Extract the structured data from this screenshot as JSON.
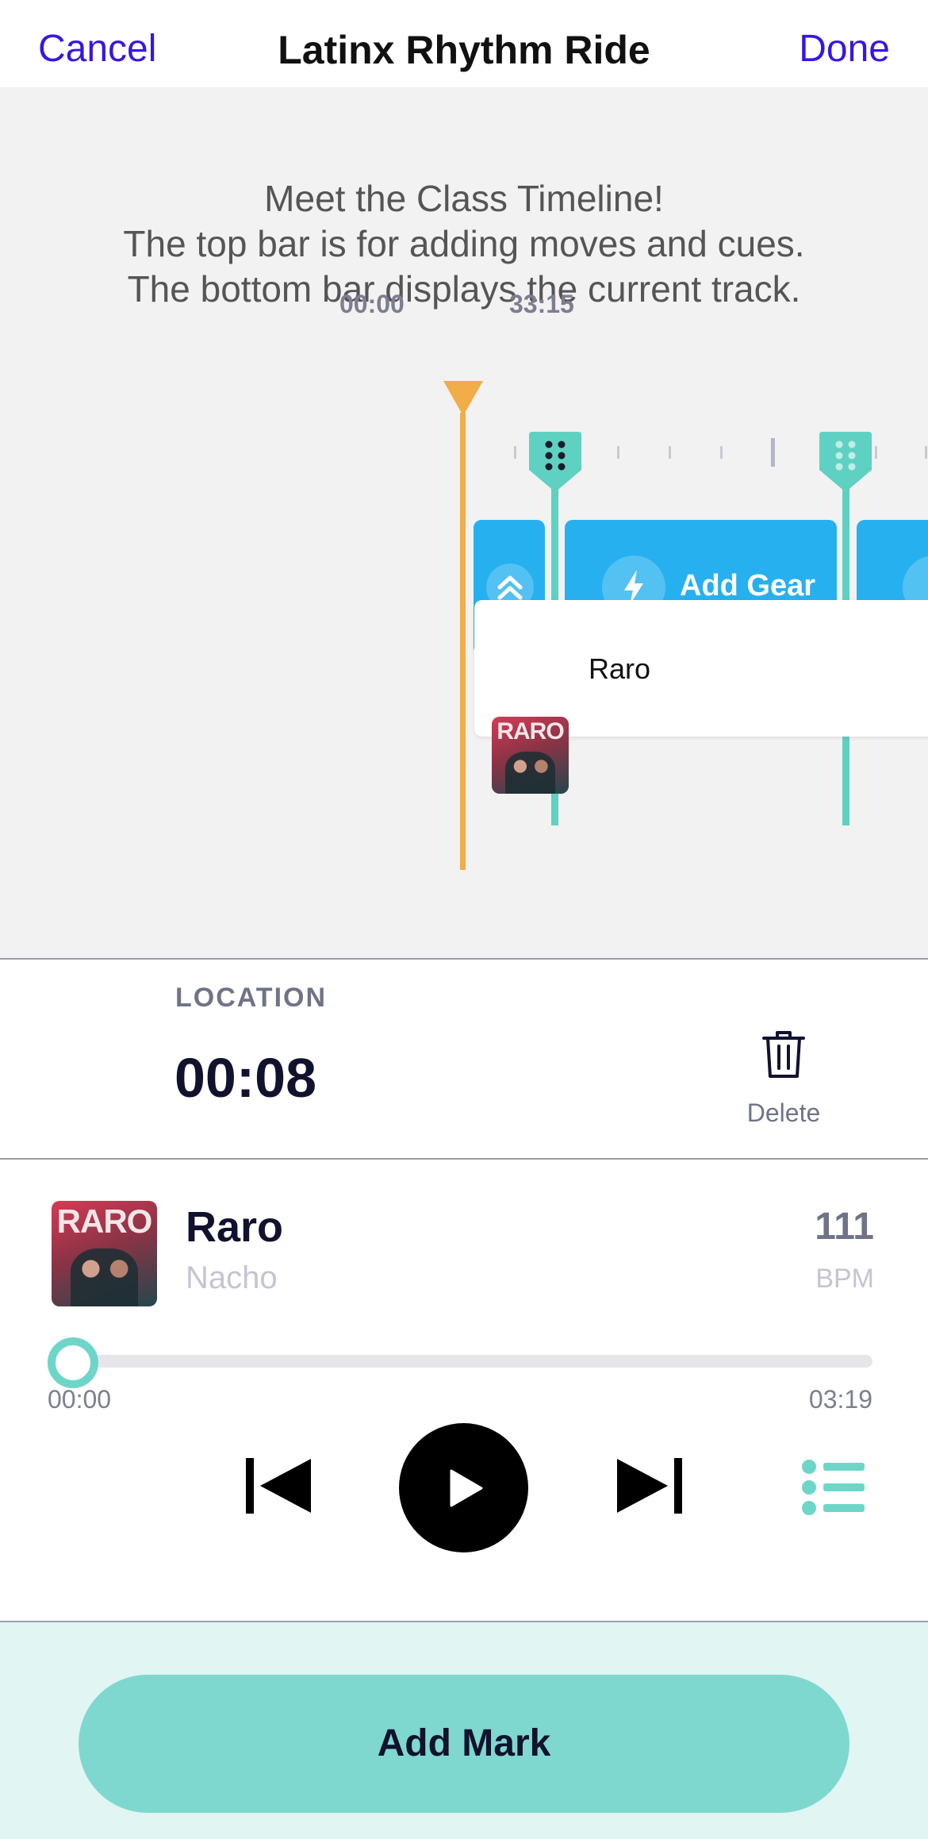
{
  "header": {
    "cancel_label": "Cancel",
    "title": "Latinx Rhythm Ride",
    "done_label": "Done"
  },
  "timeline": {
    "hint_lines": [
      "Meet the Class Timeline!",
      "The top bar is for adding moves and cues.",
      "The bottom bar displays the current track."
    ],
    "start_time": "00:00",
    "end_time": "33:15",
    "gear_label": "Add Gear",
    "track_name": "Raro",
    "cover_text": "RARO"
  },
  "location": {
    "label": "LOCATION",
    "value": "00:08",
    "delete_label": "Delete"
  },
  "now_playing": {
    "title": "Raro",
    "artist": "Nacho",
    "bpm": "111",
    "bpm_label": "BPM",
    "current_time": "00:00",
    "total_time": "03:19",
    "progress": 0,
    "cover_text": "RARO"
  },
  "actions": {
    "add_mark_label": "Add Mark"
  },
  "colors": {
    "accent": "#3a16e0",
    "teal": "#7ed8cf",
    "gear_blue": "#27b0ef",
    "playhead": "#f0ad48"
  }
}
